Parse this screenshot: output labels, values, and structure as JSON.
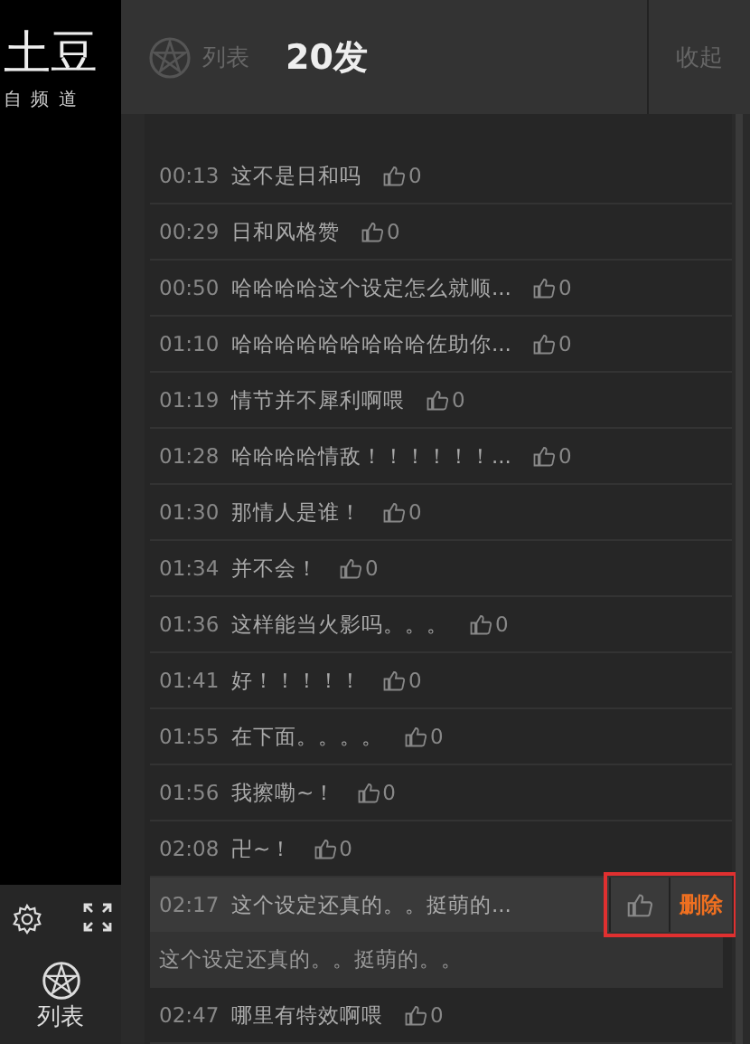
{
  "sidebar": {
    "logo": "土豆",
    "logo_sub": "自 频 道",
    "list_label": "列表"
  },
  "header": {
    "list_label": "列表",
    "count": "20发",
    "collapse": "收起"
  },
  "comments": [
    {
      "time": "00:13",
      "text": "这不是日和吗",
      "likes": "0",
      "selected": false
    },
    {
      "time": "00:29",
      "text": "日和风格赞",
      "likes": "0",
      "selected": false
    },
    {
      "time": "00:50",
      "text": "哈哈哈哈这个设定怎么就顺...",
      "likes": "0",
      "selected": false
    },
    {
      "time": "01:10",
      "text": "哈哈哈哈哈哈哈哈哈佐助你...",
      "likes": "0",
      "selected": false
    },
    {
      "time": "01:19",
      "text": "情节并不犀利啊喂",
      "likes": "0",
      "selected": false
    },
    {
      "time": "01:28",
      "text": "哈哈哈哈情敌！！！！！！...",
      "likes": "0",
      "selected": false
    },
    {
      "time": "01:30",
      "text": "那情人是谁！",
      "likes": "0",
      "selected": false
    },
    {
      "time": "01:34",
      "text": "并不会！",
      "likes": "0",
      "selected": false
    },
    {
      "time": "01:36",
      "text": "这样能当火影吗。。。",
      "likes": "0",
      "selected": false
    },
    {
      "time": "01:41",
      "text": "好！！！！！",
      "likes": "0",
      "selected": false
    },
    {
      "time": "01:55",
      "text": "在下面。。。。",
      "likes": "0",
      "selected": false
    },
    {
      "time": "01:56",
      "text": "我擦嘞~！",
      "likes": "0",
      "selected": false
    },
    {
      "time": "02:08",
      "text": "卍~！",
      "likes": "0",
      "selected": false
    },
    {
      "time": "02:17",
      "text": "这个设定还真的。。挺萌的...",
      "selected": true,
      "full_text": "这个设定还真的。。挺萌的。。",
      "delete": "删除"
    },
    {
      "time": "02:47",
      "text": "哪里有特效啊喂",
      "likes": "0",
      "selected": false
    }
  ]
}
